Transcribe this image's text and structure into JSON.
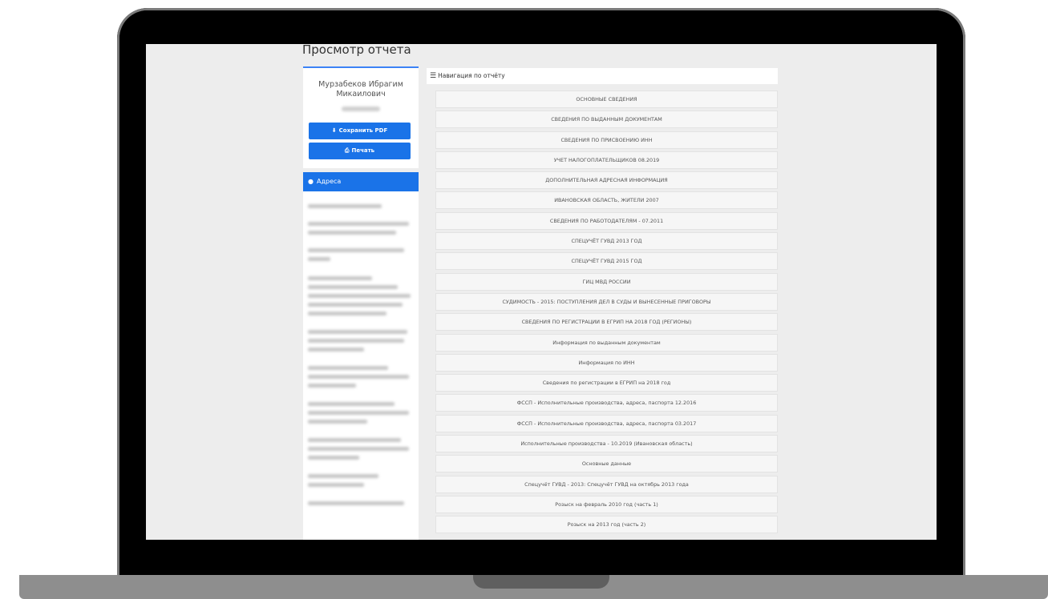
{
  "page": {
    "title": "Просмотр отчета"
  },
  "profile": {
    "name": "Мурзабеков Ибрагим Микаилович",
    "save_pdf_label": "Сохранить PDF",
    "print_label": "Печать"
  },
  "addresses": {
    "header": "Адреса"
  },
  "navigation": {
    "header": "Навигация по отчёту",
    "items": [
      "ОСНОВНЫЕ СВЕДЕНИЯ",
      "СВЕДЕНИЯ ПО ВЫДАННЫМ ДОКУМЕНТАМ",
      "СВЕДЕНИЯ ПО ПРИСВОЕНИЮ ИНН",
      "УЧЕТ НАЛОГОПЛАТЕЛЬЩИКОВ 08.2019",
      "ДОПОЛНИТЕЛЬНАЯ АДРЕСНАЯ ИНФОРМАЦИЯ",
      "ИВАНОВСКАЯ ОБЛАСТЬ, ЖИТЕЛИ 2007",
      "СВЕДЕНИЯ ПО РАБОТОДАТЕЛЯМ - 07.2011",
      "СПЕЦУЧЁТ ГУВД 2013 ГОД",
      "СПЕЦУЧЁТ ГУВД 2015 ГОД",
      "ГИЦ МВД РОССИИ",
      "СУДИМОСТЬ - 2015: ПОСТУПЛЕНИЯ ДЕЛ В СУДЫ И ВЫНЕСЕННЫЕ ПРИГОВОРЫ",
      "СВЕДЕНИЯ ПО РЕГИСТРАЦИИ В ЕГРИП НА 2018 ГОД (РЕГИОНЫ)",
      "Информация по выданным документам",
      "Информация по ИНН",
      "Сведения по регистрации в ЕГРИП на 2018 год",
      "ФССП - Исполнительные производства, адреса, паспорта 12.2016",
      "ФССП - Исполнительные производства, адреса, паспорта 03.2017",
      "Исполнительные производства - 10.2019 (Ивановская область)",
      "Основные данные",
      "Спецучёт ГУВД - 2013: Спецучёт ГУВД на октябрь 2013 года",
      "Розыск на февраль 2010 год (часть 1)",
      "Розыск на 2013 год (часть 2)"
    ]
  },
  "icons": {
    "download": "download-icon",
    "print": "printer-icon",
    "location": "map-marker-icon",
    "menu": "bars-icon"
  },
  "colors": {
    "accent": "#1a73e8",
    "background": "#ededed",
    "frame": "#000000"
  }
}
